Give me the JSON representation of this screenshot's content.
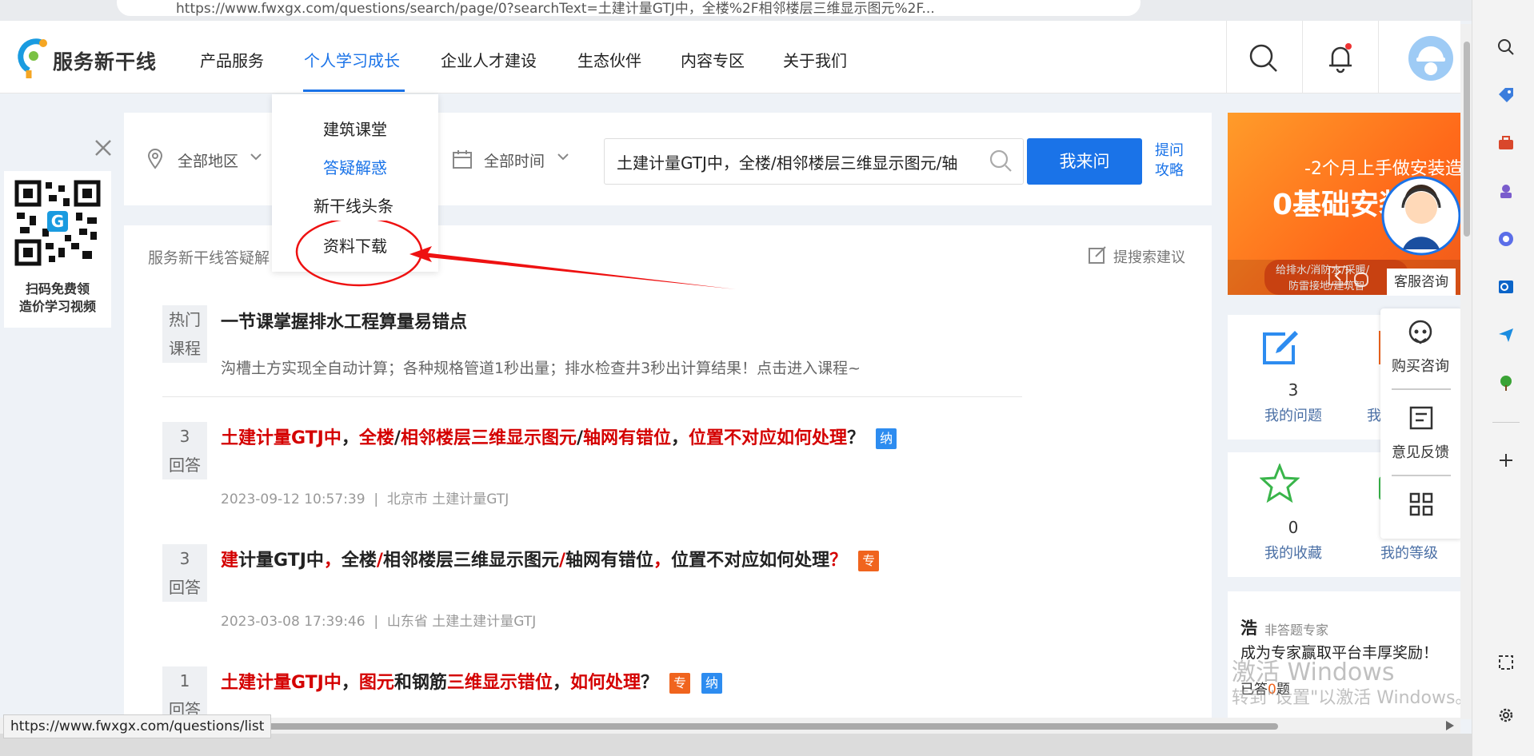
{
  "browser": {
    "url": "https://www.fwxgx.com/questions/search/page/0?searchText=土建计量GTJ中，全楼%2F相邻楼层三维显示图元%2F..."
  },
  "site": {
    "logo_text": "服务新干线",
    "nav": [
      "产品服务",
      "个人学习成长",
      "企业人才建设",
      "生态伙伴",
      "内容专区",
      "关于我们"
    ],
    "active_nav": "个人学习成长",
    "accent_color": "#1a73e8"
  },
  "dropdown": {
    "items": [
      "建筑课堂",
      "答疑解惑",
      "新干线头条",
      "资料下载"
    ],
    "active": "答疑解惑"
  },
  "qr": {
    "line1": "扫码免费领",
    "line2": "造价学习视频"
  },
  "filters": {
    "region": "全部地区",
    "time": "全部时间",
    "search_value": "土建计量GTJ中，全楼/相邻楼层三维显示图元/轴",
    "ask_button": "我来问",
    "ask_tips": "提问攻略"
  },
  "results": {
    "section_label": "服务新干线答疑解",
    "suggest_label": "提搜索建议",
    "hot": {
      "tag1": "热门",
      "tag2": "课程",
      "title": "一节课掌握排水工程算量易错点",
      "desc": "沟槽土方实现全自动计算；各种规格管道1秒出量；排水检查井3秒出计算结果！点击进入课程~"
    },
    "items": [
      {
        "count": "3",
        "count_label": "回答",
        "title_html": "土建计量GTJ中|，|全楼|/|相邻楼层三维显示图元|/|轴网有错位|，|位置不对应如何处理|？",
        "badges": [
          {
            "text": "纳",
            "color": "blue"
          }
        ],
        "date": "2023-09-12 10:57:39",
        "region": "北京市 土建计量GTJ"
      },
      {
        "count": "3",
        "count_label": "回答",
        "title_html": "建|计量GTJ中|，|全楼|/|相邻楼层三维显示图元|/|轴网有错位|，|位置不对应如何处理|？",
        "badges": [
          {
            "text": "专",
            "color": "orange"
          }
        ],
        "date": "2023-03-08 17:39:46",
        "region": "山东省 土建土建计量GTJ"
      },
      {
        "count": "1",
        "count_label": "回答",
        "title_html": "土建计量GTJ中|，|图元|和钢筋|三维显示错位|，|如何处理|？",
        "badges": [
          {
            "text": "专",
            "color": "orange"
          },
          {
            "text": "纳",
            "color": "blue"
          }
        ],
        "date": "",
        "region": ""
      }
    ]
  },
  "banner": {
    "line1": "-2个月上手做安装造",
    "line2": "0基础安装",
    "line3": "给排水/消防水/采暖/",
    "line4": "防雷接地/建筑智",
    "service_label": "客服咨询"
  },
  "stats": [
    {
      "value": "3",
      "label": "我的问题"
    },
    {
      "value": "",
      "label": "我"
    },
    {
      "value": "0",
      "label": "我的收藏"
    },
    {
      "value": "",
      "label": "我的等级"
    }
  ],
  "float_panel": {
    "buy": "购买咨询",
    "feedback": "意见反馈"
  },
  "expert": {
    "name": "浩",
    "role": "非答题专家",
    "slogan": "成为专家赢取平台丰厚奖励！",
    "answered_prefix": "已答",
    "answered_count": "0",
    "answered_suffix": "题"
  },
  "watermark": {
    "line1": "激活 Windows",
    "line2": "转到\"设置\"以激活 Windows。"
  },
  "status_url": "https://www.fwxgx.com/questions/list"
}
